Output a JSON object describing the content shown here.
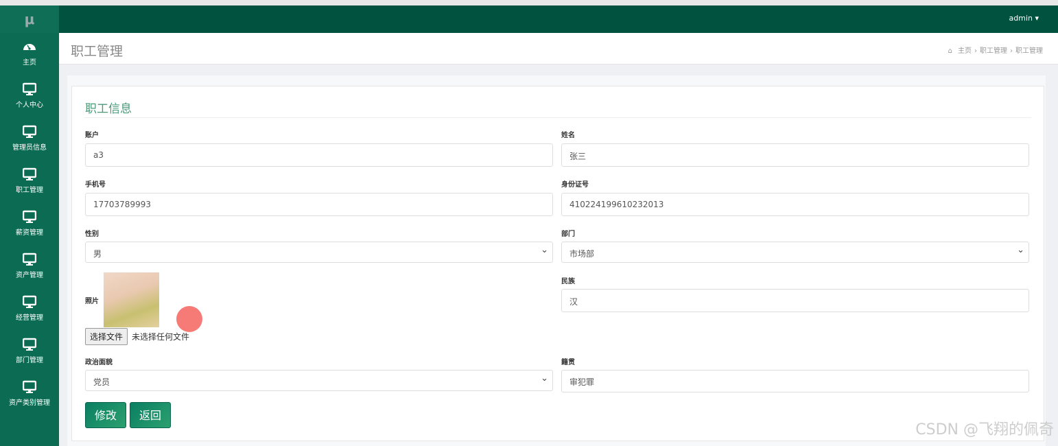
{
  "logo": "μ",
  "user": "admin",
  "sidebar": {
    "items": [
      {
        "label": "主页",
        "icon": "dashboard-icon"
      },
      {
        "label": "个人中心",
        "icon": "monitor-icon"
      },
      {
        "label": "管理员信息",
        "icon": "monitor-icon"
      },
      {
        "label": "职工管理",
        "icon": "monitor-icon"
      },
      {
        "label": "薪资管理",
        "icon": "monitor-icon"
      },
      {
        "label": "资产管理",
        "icon": "monitor-icon"
      },
      {
        "label": "经营管理",
        "icon": "monitor-icon"
      },
      {
        "label": "部门管理",
        "icon": "monitor-icon"
      },
      {
        "label": "资产类别管理",
        "icon": "monitor-icon"
      }
    ]
  },
  "header": {
    "title": "职工管理",
    "breadcrumb": [
      "主页",
      "职工管理",
      "职工管理"
    ]
  },
  "form": {
    "title": "职工信息",
    "account": {
      "label": "账户",
      "value": "a3"
    },
    "name": {
      "label": "姓名",
      "value": "张三"
    },
    "phone": {
      "label": "手机号",
      "value": "17703789993"
    },
    "idcard": {
      "label": "身份证号",
      "value": "410224199610232013"
    },
    "gender": {
      "label": "性别",
      "value": "男"
    },
    "dept": {
      "label": "部门",
      "value": "市场部"
    },
    "photo": {
      "label": "照片",
      "choose": "选择文件",
      "nofile": "未选择任何文件"
    },
    "ethnic": {
      "label": "民族",
      "value": "汉"
    },
    "political": {
      "label": "政治面貌",
      "value": "党员"
    },
    "native": {
      "label": "籍贯",
      "value": "审犯罪"
    },
    "submit": "修改",
    "back": "返回"
  },
  "watermark": "CSDN @飞翔的佩奇",
  "colors": {
    "sidebar": "#0b6b53",
    "topbar": "#015340",
    "accent": "#4a9a78"
  }
}
